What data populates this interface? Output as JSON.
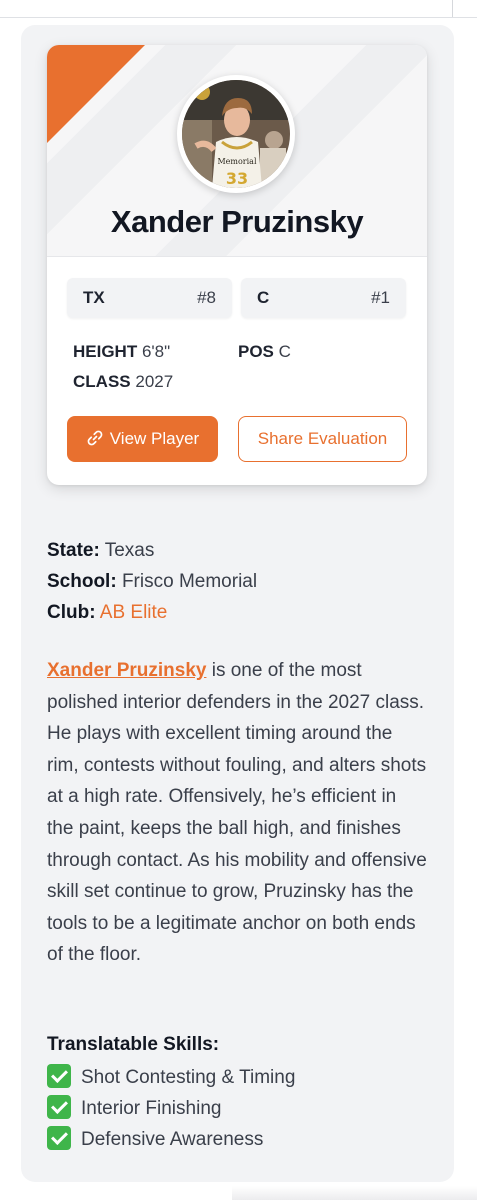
{
  "player": {
    "name": "Xander Pruzinsky",
    "avatar_icon": "player-photo",
    "jersey_number": "33",
    "jersey_text": "Memorial"
  },
  "chips": [
    {
      "key": "TX",
      "value": "#8"
    },
    {
      "key": "C",
      "value": "#1"
    }
  ],
  "attributes": {
    "height_label": "HEIGHT",
    "height_value": "6'8\"",
    "pos_label": "POS",
    "pos_value": "C",
    "class_label": "CLASS",
    "class_value": "2027"
  },
  "buttons": {
    "view_player": "View Player",
    "share_evaluation": "Share Evaluation"
  },
  "info": {
    "state_label": "State:",
    "state_value": "Texas",
    "school_label": "School:",
    "school_value": "Frisco Memorial",
    "club_label": "Club:",
    "club_value": "AB Elite"
  },
  "evaluation": {
    "name_link": "Xander Pruzinsky",
    "text": " is one of the most polished interior defenders in the 2027 class. He plays with excellent timing around the rim, contests without fouling, and alters shots at a high rate. Offensively, he’s efficient in the paint, keeps the ball high, and finishes through contact. As his mobility and offensive skill set continue to grow, Pruzinsky has the tools to be a legitimate anchor on both ends of the floor."
  },
  "skills": {
    "title": "Translatable Skills:",
    "items": [
      "Shot Contesting & Timing",
      "Interior Finishing",
      "Defensive Awareness"
    ]
  },
  "colors": {
    "accent": "#e8702f",
    "check": "#3fb54a"
  }
}
